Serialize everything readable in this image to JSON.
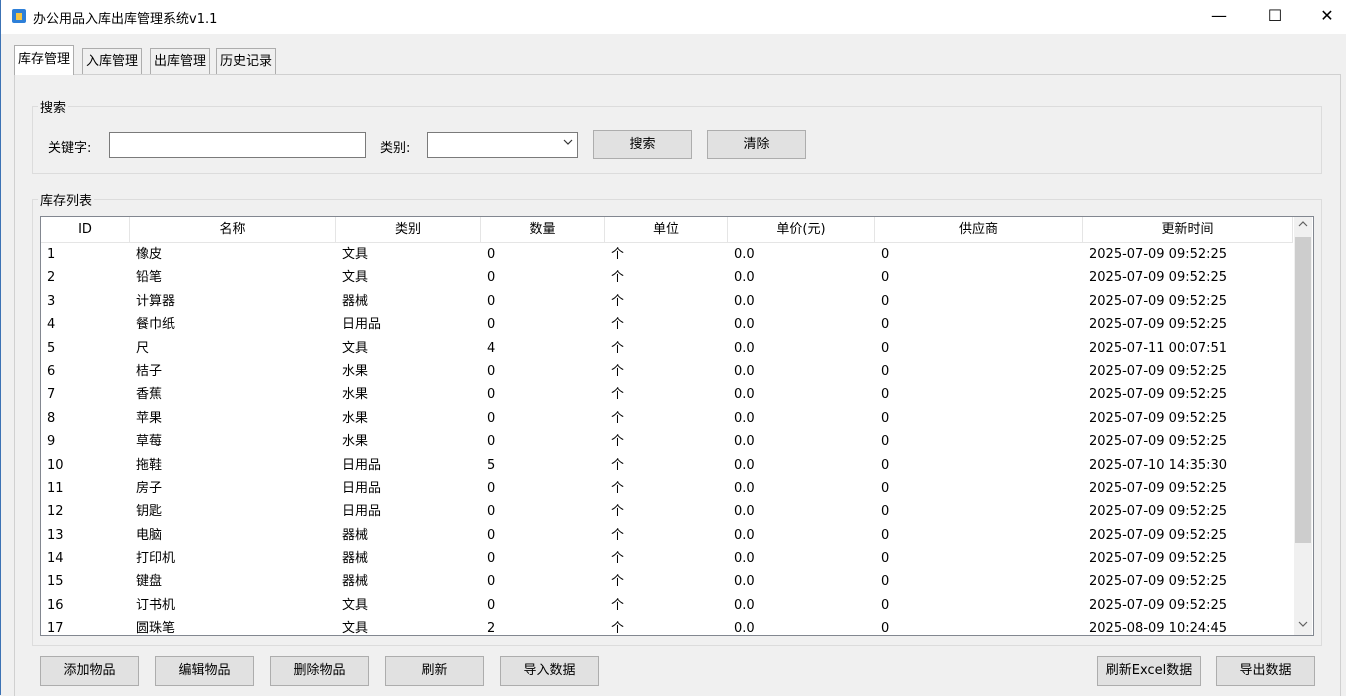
{
  "window": {
    "title": "办公用品入库出库管理系统v1.1",
    "minimize_glyph": "—",
    "maximize_glyph": "☐",
    "close_glyph": "✕"
  },
  "tabs": [
    {
      "label": "库存管理",
      "active": true
    },
    {
      "label": "入库管理",
      "active": false
    },
    {
      "label": "出库管理",
      "active": false
    },
    {
      "label": "历史记录",
      "active": false
    }
  ],
  "search": {
    "group_label": "搜索",
    "keyword_label": "关键字:",
    "keyword_value": "",
    "category_label": "类别:",
    "category_value": "",
    "search_button": "搜索",
    "clear_button": "清除"
  },
  "inventory": {
    "group_label": "库存列表",
    "columns": [
      "ID",
      "名称",
      "类别",
      "数量",
      "单位",
      "单价(元)",
      "供应商",
      "更新时间"
    ],
    "rows": [
      [
        "1",
        "橡皮",
        "文具",
        "0",
        "个",
        "0.0",
        "0",
        "2025-07-09 09:52:25"
      ],
      [
        "2",
        "铅笔",
        "文具",
        "0",
        "个",
        "0.0",
        "0",
        "2025-07-09 09:52:25"
      ],
      [
        "3",
        "计算器",
        "器械",
        "0",
        "个",
        "0.0",
        "0",
        "2025-07-09 09:52:25"
      ],
      [
        "4",
        "餐巾纸",
        "日用品",
        "0",
        "个",
        "0.0",
        "0",
        "2025-07-09 09:52:25"
      ],
      [
        "5",
        "尺",
        "文具",
        "4",
        "个",
        "0.0",
        "0",
        "2025-07-11 00:07:51"
      ],
      [
        "6",
        "桔子",
        "水果",
        "0",
        "个",
        "0.0",
        "0",
        "2025-07-09 09:52:25"
      ],
      [
        "7",
        "香蕉",
        "水果",
        "0",
        "个",
        "0.0",
        "0",
        "2025-07-09 09:52:25"
      ],
      [
        "8",
        "苹果",
        "水果",
        "0",
        "个",
        "0.0",
        "0",
        "2025-07-09 09:52:25"
      ],
      [
        "9",
        "草莓",
        "水果",
        "0",
        "个",
        "0.0",
        "0",
        "2025-07-09 09:52:25"
      ],
      [
        "10",
        "拖鞋",
        "日用品",
        "5",
        "个",
        "0.0",
        "0",
        "2025-07-10 14:35:30"
      ],
      [
        "11",
        "房子",
        "日用品",
        "0",
        "个",
        "0.0",
        "0",
        "2025-07-09 09:52:25"
      ],
      [
        "12",
        "钥匙",
        "日用品",
        "0",
        "个",
        "0.0",
        "0",
        "2025-07-09 09:52:25"
      ],
      [
        "13",
        "电脑",
        "器械",
        "0",
        "个",
        "0.0",
        "0",
        "2025-07-09 09:52:25"
      ],
      [
        "14",
        "打印机",
        "器械",
        "0",
        "个",
        "0.0",
        "0",
        "2025-07-09 09:52:25"
      ],
      [
        "15",
        "键盘",
        "器械",
        "0",
        "个",
        "0.0",
        "0",
        "2025-07-09 09:52:25"
      ],
      [
        "16",
        "订书机",
        "文具",
        "0",
        "个",
        "0.0",
        "0",
        "2025-07-09 09:52:25"
      ],
      [
        "17",
        "圆珠笔",
        "文具",
        "2",
        "个",
        "0.0",
        "0",
        "2025-08-09 10:24:45"
      ]
    ],
    "scroll_up_glyph": "▲",
    "scroll_down_glyph": "▼"
  },
  "actions": {
    "add": "添加物品",
    "edit": "编辑物品",
    "delete": "删除物品",
    "refresh": "刷新",
    "import": "导入数据",
    "refresh_excel": "刷新Excel数据",
    "export": "导出数据"
  }
}
